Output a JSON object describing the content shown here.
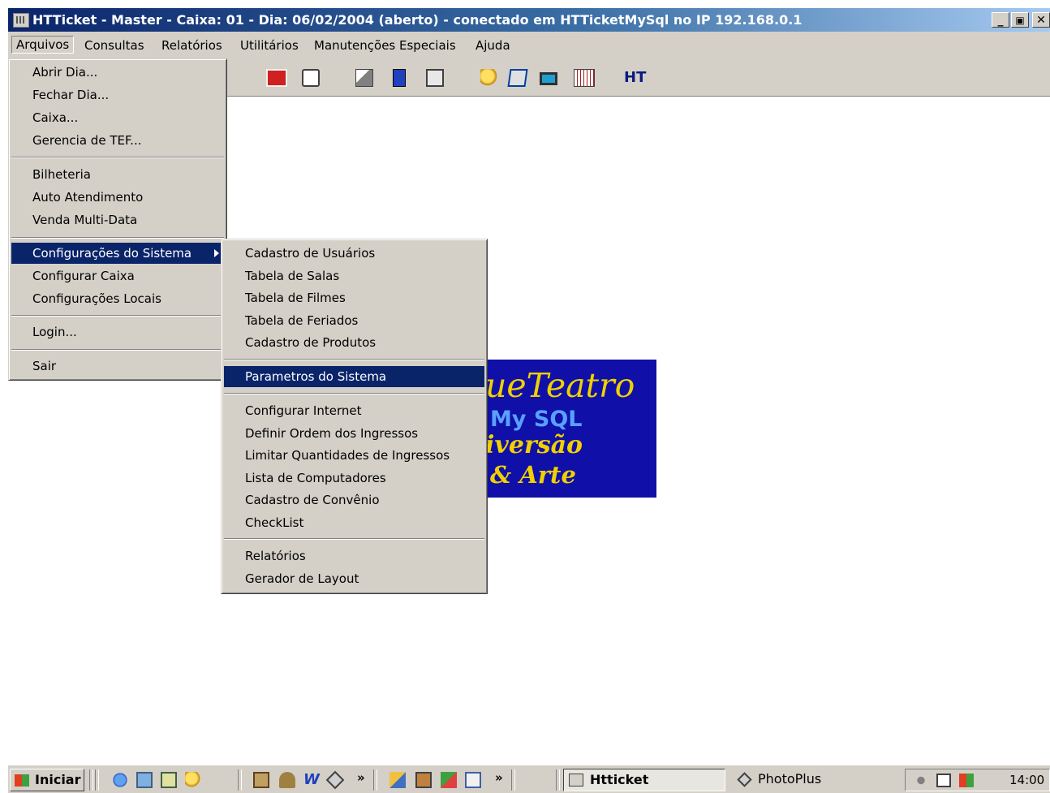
{
  "window": {
    "title": "HTTicket  - Master - Caixa: 01 -  Dia: 06/02/2004  (aberto) - conectado em HTTicketMySql  no IP  192.168.0.1",
    "minimize_glyph": "_",
    "maximize_glyph": "▣",
    "close_glyph": "✕"
  },
  "menubar": [
    {
      "label": "Arquivos",
      "open": true
    },
    {
      "label": "Consultas"
    },
    {
      "label": "Relatórios"
    },
    {
      "label": "Utilitários"
    },
    {
      "label": "Manutenções Especiais"
    },
    {
      "label": "Ajuda"
    }
  ],
  "toolbar": {
    "icons": [
      "calendar-icon",
      "clock-icon",
      "copy-icon",
      "dollar-icon",
      "report-icon",
      "search-icon",
      "notepad-icon",
      "monitor-icon",
      "grid-calendar-icon",
      "ht-logo-icon"
    ],
    "ht_label": "HT"
  },
  "logo": {
    "line1": "ueTeatro",
    "line2": "My SQL",
    "line3": "iversão",
    "line4": "& Arte"
  },
  "arquivos_menu": [
    "Abrir Dia...",
    "Fechar Dia...",
    "Caixa...",
    "Gerencia de TEF...",
    "Bilheteria",
    "Auto Atendimento",
    "Venda Multi-Data",
    "Configurações do Sistema",
    "Configurar Caixa",
    "Configurações Locais",
    "Login...",
    "Sair"
  ],
  "config_submenu": [
    "Cadastro de Usuários",
    "Tabela de Salas",
    "Tabela de Filmes",
    "Tabela de Feriados",
    "Cadastro de Produtos",
    "Parametros do Sistema",
    "Configurar Internet",
    "Definir Ordem dos Ingressos",
    "Limitar Quantidades de Ingressos",
    "Lista de Computadores",
    "Cadastro de Convênio",
    "CheckList",
    "Relatórios",
    "Gerador de Layout"
  ],
  "taskbar": {
    "start_label": "Iniciar",
    "chevron": "»",
    "tasks": [
      {
        "label": "Htticket",
        "active": true
      },
      {
        "label": "PhotoPlus",
        "active": false
      }
    ],
    "clock": "14:00"
  },
  "colors": {
    "titlebar_start": "#0a246a",
    "titlebar_end": "#a6caf0",
    "face": "#d4d0c8",
    "highlight": "#0a246a",
    "logo_bg": "#1010a8",
    "logo_yellow": "#f0d000",
    "logo_blue": "#5aa0ff"
  }
}
